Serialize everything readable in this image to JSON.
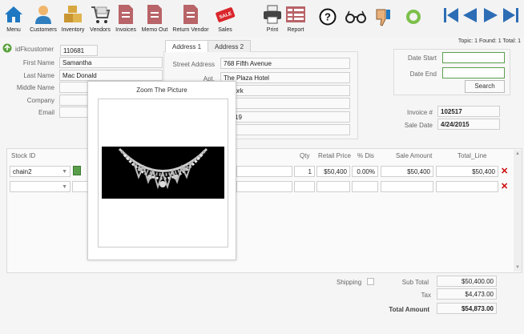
{
  "toolbar": {
    "items": [
      {
        "label": "Menu",
        "icon": "home-icon"
      },
      {
        "label": "Customers",
        "icon": "user-icon"
      },
      {
        "label": "Inventory",
        "icon": "boxes-icon"
      },
      {
        "label": "Vendors",
        "icon": "cart-icon"
      },
      {
        "label": "Invoices",
        "icon": "document-icon"
      },
      {
        "label": "Memo Out",
        "icon": "document-icon"
      },
      {
        "label": "Return Vendor",
        "icon": "document-icon"
      },
      {
        "label": "Sales",
        "icon": "sale-tag-icon"
      },
      {
        "label": "Print",
        "icon": "printer-icon"
      },
      {
        "label": "Report",
        "icon": "report-icon"
      }
    ],
    "sale_tag": "SALE"
  },
  "status": {
    "text": "Topic: 1 Found: 1 Total: 1"
  },
  "customer": {
    "id_label": "idFkcustomer",
    "id_value": "110681",
    "first_name_label": "First Name",
    "first_name": "Samantha",
    "last_name_label": "Last Name",
    "last_name": "Mac Donald",
    "middle_name_label": "Middle Name",
    "middle_name": "",
    "company_label": "Company",
    "company": "",
    "email_label": "Email",
    "email": ""
  },
  "address": {
    "tabs": [
      "Address 1",
      "Address 2"
    ],
    "street_label": "Street Address",
    "street": "768 Fifth Avenue",
    "apt_label": "Apt.",
    "apt": "The Plaza Hotel",
    "city_partial": "York",
    "zip_partial": "19"
  },
  "search": {
    "date_start_label": "Date Start",
    "date_start": "",
    "date_end_label": "Date End",
    "date_end": "",
    "button": "Search"
  },
  "invoice": {
    "number_label": "Invoice #",
    "number": "102517",
    "date_label": "Sale Date",
    "date": "4/24/2015"
  },
  "grid": {
    "headers": {
      "stock_id": "Stock ID",
      "qty": "Qty",
      "retail": "Retail Price",
      "dis": "% Dis",
      "sale": "Sale Amount",
      "total": "Total_Line"
    },
    "row1": {
      "stock_id": "chain2",
      "qty": "1",
      "retail": "$50,400",
      "dis": "0.00%",
      "sale": "$50,400",
      "total": "$50,400"
    }
  },
  "totals": {
    "shipping_label": "Shipping",
    "subtotal_label": "Sub Total",
    "subtotal": "$50,400.00",
    "tax_label": "Tax",
    "tax": "$4,473.00",
    "total_label": "Total Amount",
    "total": "$54,873.00"
  },
  "popup": {
    "title": "Zoom The Picture"
  },
  "colors": {
    "accent_blue": "#2d6db5",
    "green": "#5a9e4b",
    "delete_red": "#cc0000"
  }
}
